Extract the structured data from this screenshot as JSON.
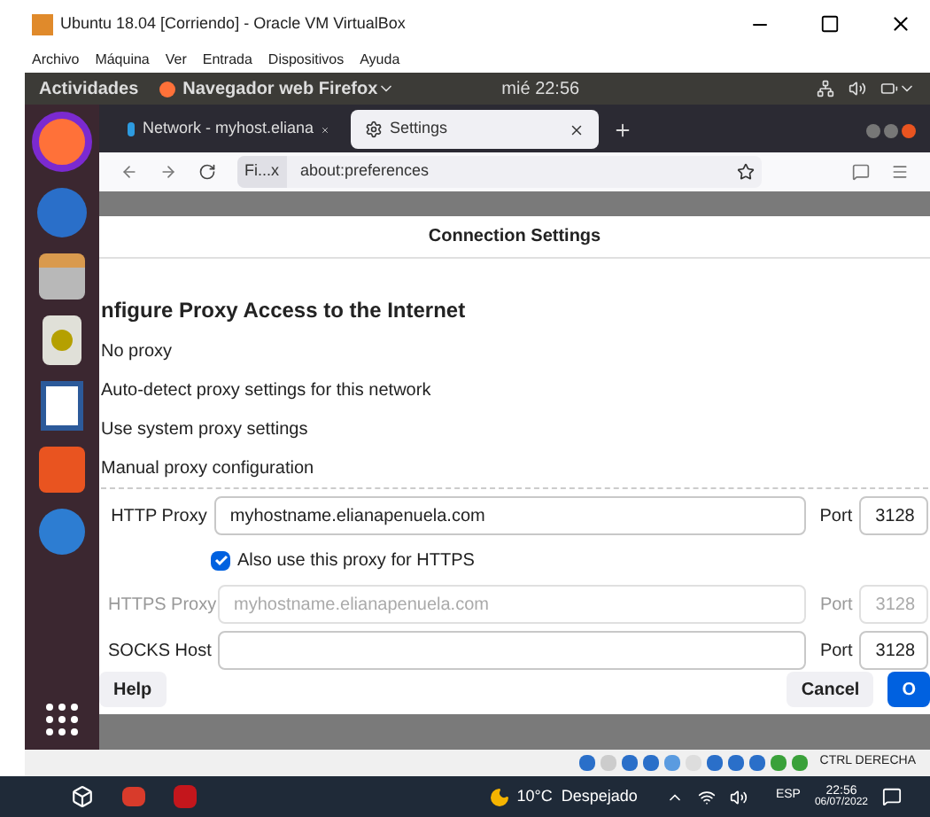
{
  "host_window": {
    "title": "Ubuntu 18.04 [Corriendo] - Oracle VM VirtualBox",
    "menu": [
      "Archivo",
      "Máquina",
      "Ver",
      "Entrada",
      "Dispositivos",
      "Ayuda"
    ]
  },
  "top_bar": {
    "activities": "Actividades",
    "app": "Navegador web Firefox",
    "clock": "mié 22:56"
  },
  "browser": {
    "tabs": [
      {
        "label": "Network - myhost.eliana",
        "selected": false
      },
      {
        "label": "Settings",
        "selected": true
      }
    ],
    "identity": "Fi...x",
    "url": "about:preferences"
  },
  "dialog": {
    "title": "Connection Settings",
    "heading": "nfigure Proxy Access to the Internet",
    "options": [
      "No proxy",
      "Auto-detect proxy settings for this network",
      "Use system proxy settings",
      "Manual proxy configuration"
    ],
    "fields": [
      {
        "kind": "field",
        "label": "HTTP Proxy",
        "value": "myhostname.elianapenuela.com",
        "port_label": "Port",
        "port": "3128",
        "disabled": false
      },
      {
        "kind": "checkbox",
        "label": "Also use this proxy for HTTPS",
        "checked": true
      },
      {
        "kind": "field",
        "label": "HTTPS Proxy",
        "value": "myhostname.elianapenuela.com",
        "port_label": "Port",
        "port": "3128",
        "disabled": true
      },
      {
        "kind": "field",
        "label": "SOCKS Host",
        "port_label": "Port",
        "port": "3128",
        "disabled": false
      }
    ],
    "buttons": [
      {
        "label": "Help",
        "kind": "plain"
      },
      {
        "label": "Cancel",
        "kind": "plain"
      },
      {
        "label": "O",
        "kind": "primary"
      }
    ]
  },
  "status_bar": {
    "key": "CTRL DERECHA"
  },
  "taskbar": {
    "weather": "10°C  Despejado",
    "language": "ESP",
    "time": "22:56",
    "date": "06/07/2022"
  }
}
